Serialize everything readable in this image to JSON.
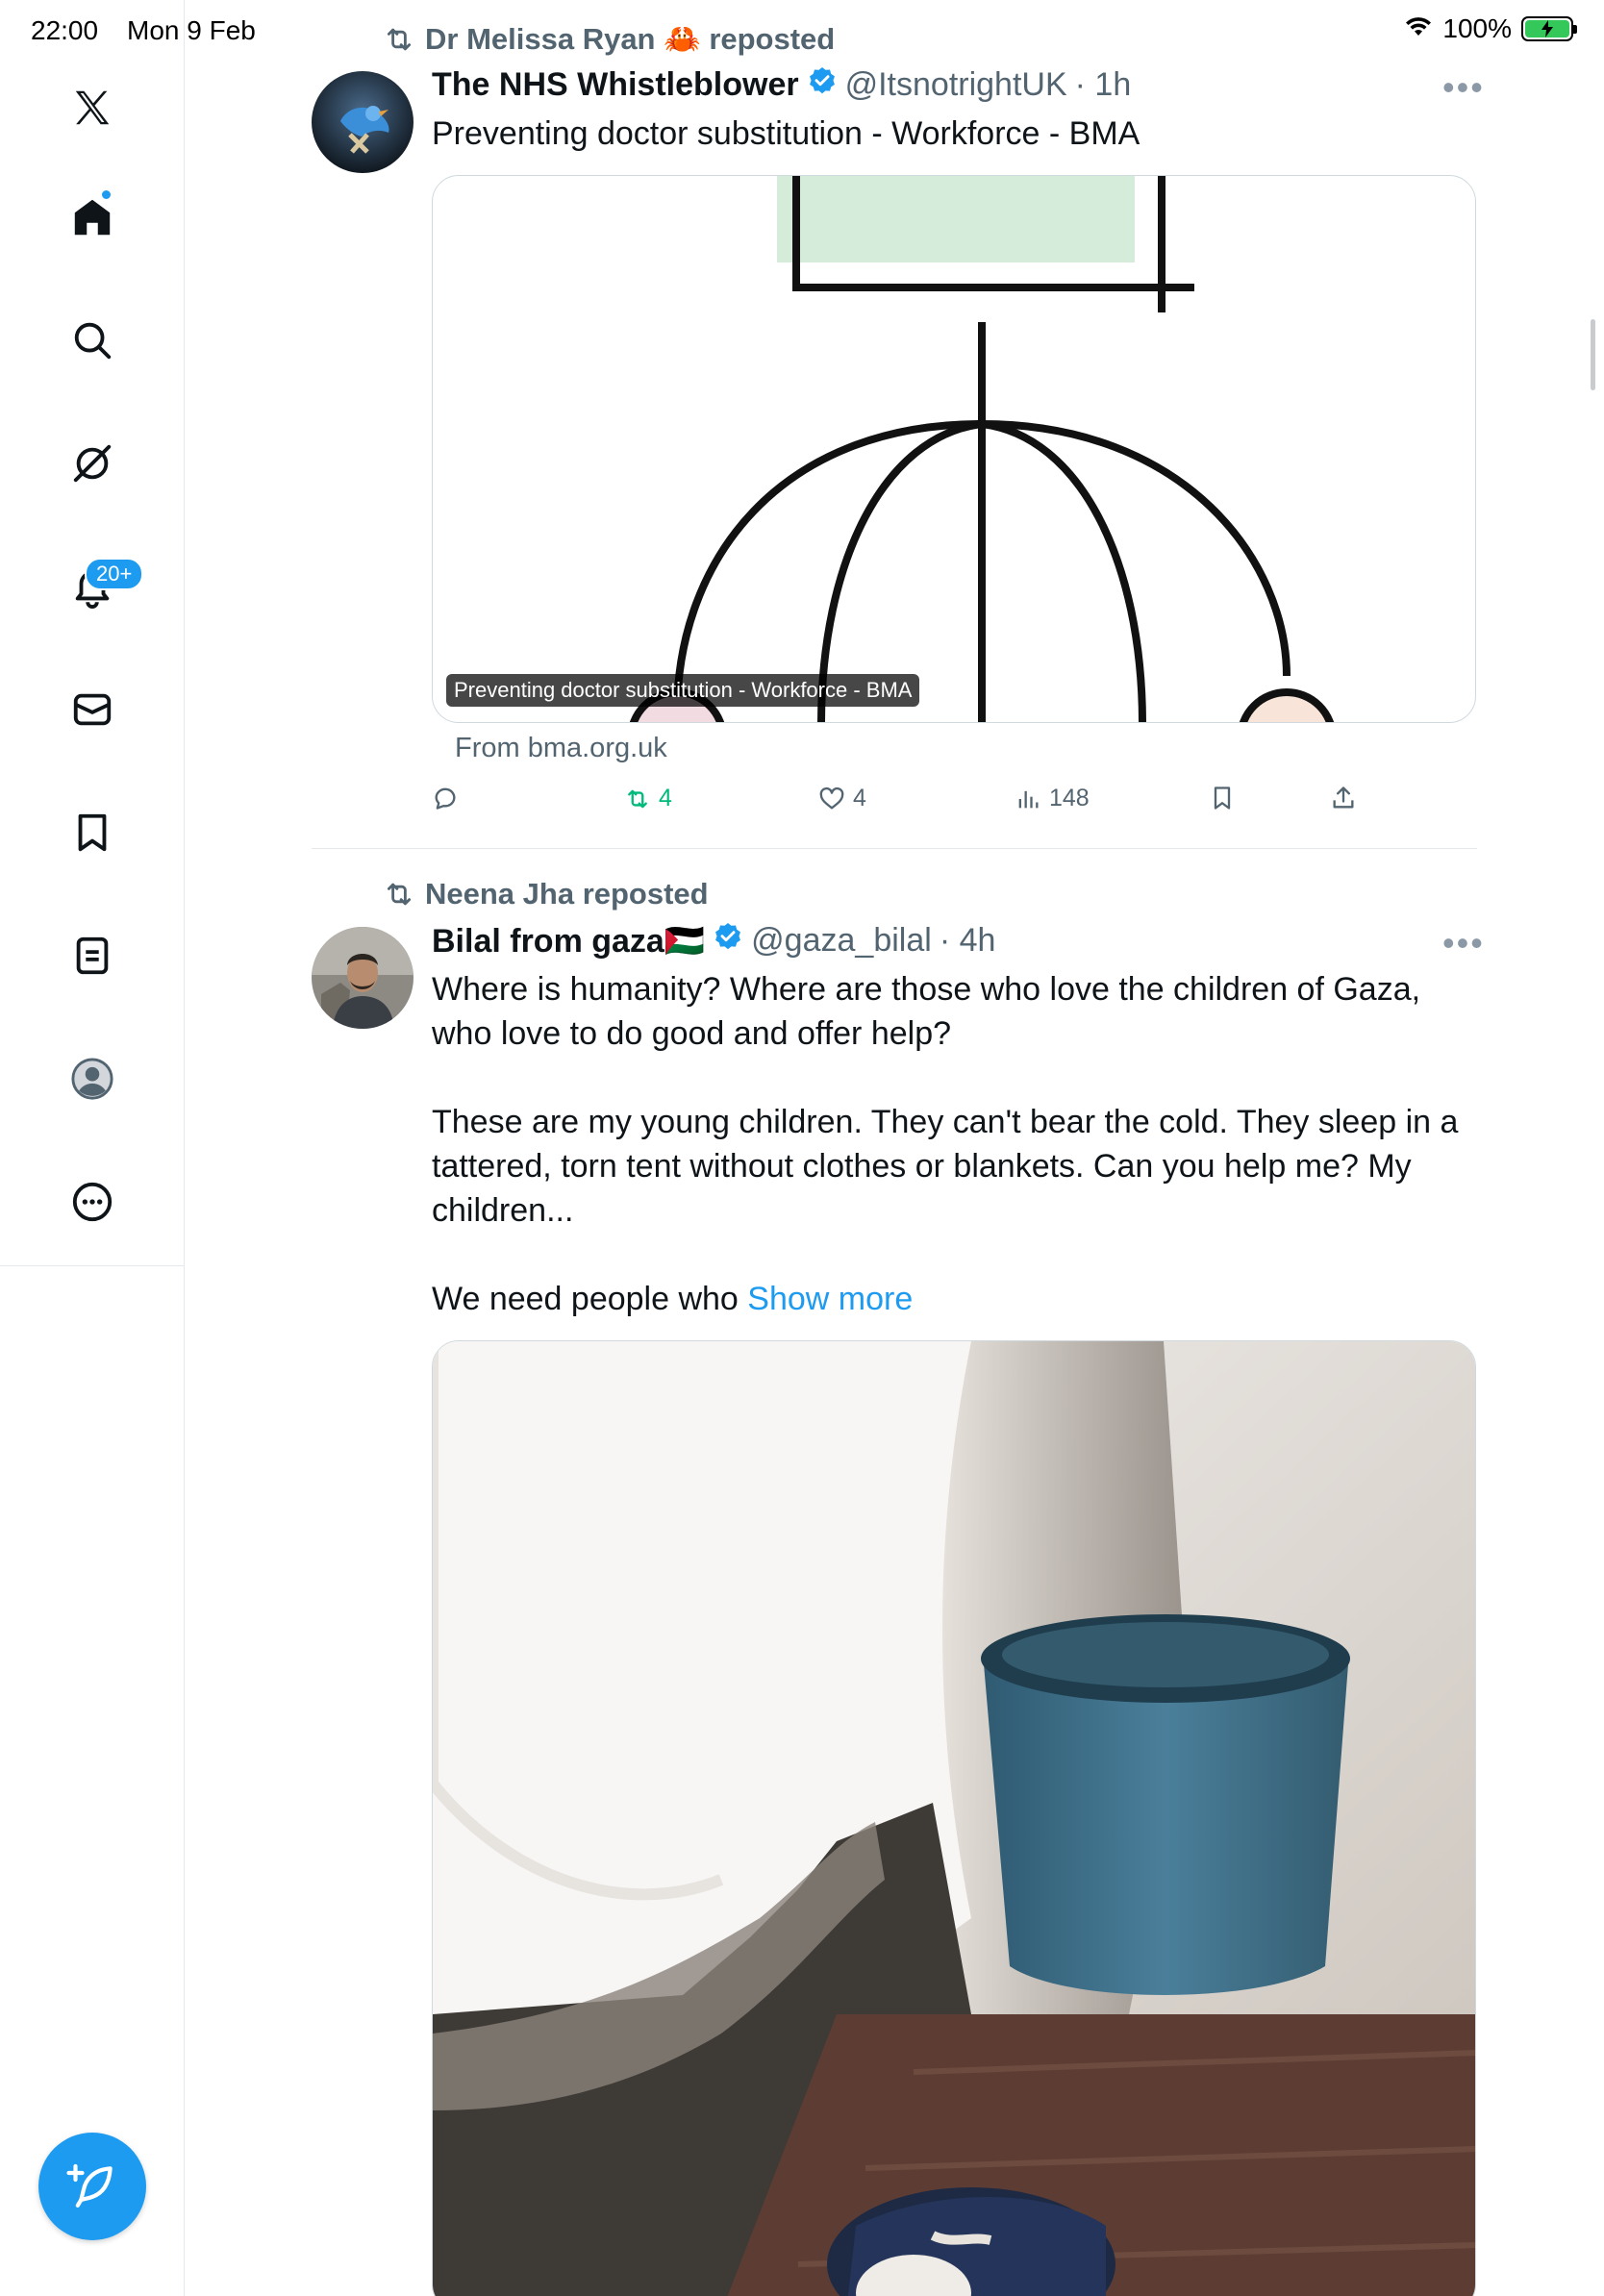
{
  "status_bar": {
    "time": "22:00",
    "date": "Mon 9 Feb",
    "battery": "100%",
    "icons": [
      "wifi-icon",
      "battery-charging-icon"
    ]
  },
  "nav": {
    "items": [
      {
        "name": "x-logo",
        "icon": "x-logo-icon"
      },
      {
        "name": "home",
        "icon": "home-icon"
      },
      {
        "name": "explore",
        "icon": "search-icon"
      },
      {
        "name": "grok",
        "icon": "grok-icon"
      },
      {
        "name": "notifications",
        "icon": "bell-icon"
      },
      {
        "name": "messages",
        "icon": "mail-icon"
      },
      {
        "name": "bookmarks",
        "icon": "bookmark-icon"
      },
      {
        "name": "lists",
        "icon": "list-icon"
      },
      {
        "name": "profile",
        "icon": "profile-icon"
      },
      {
        "name": "more",
        "icon": "more-circle-icon"
      }
    ],
    "notification_badge": "20+",
    "compose_icon": "compose-feather-icon",
    "accent": "#1d9bf0"
  },
  "tweets": [
    {
      "reposted_by": "Dr Melissa Ryan 🦀 reposted",
      "display_name": "The NHS Whistleblower",
      "verified": true,
      "handle": "@ItsnotrightUK",
      "time": "· 1h",
      "text": "Preventing doctor substitution - Workforce - BMA",
      "card": {
        "overlay_label": "Preventing doctor substitution - Workforce - BMA",
        "source": "From bma.org.uk"
      },
      "actions": {
        "replies": "",
        "reposts": "4",
        "likes": "4",
        "views": "148"
      }
    },
    {
      "reposted_by": "Neena Jha reposted",
      "display_name": "Bilal from gaza🇵🇸",
      "verified": true,
      "handle": "@gaza_bilal",
      "time": "· 4h",
      "text_p1": "Where is humanity? Where are those who love the children of Gaza, who love to do good and offer help?",
      "text_p2": "These are my young children. They can't bear the cold. They sleep in a tattered, torn tent without clothes or blankets. Can you help me? My children...",
      "text_p3": "We need people who ",
      "show_more": "Show more"
    }
  ]
}
